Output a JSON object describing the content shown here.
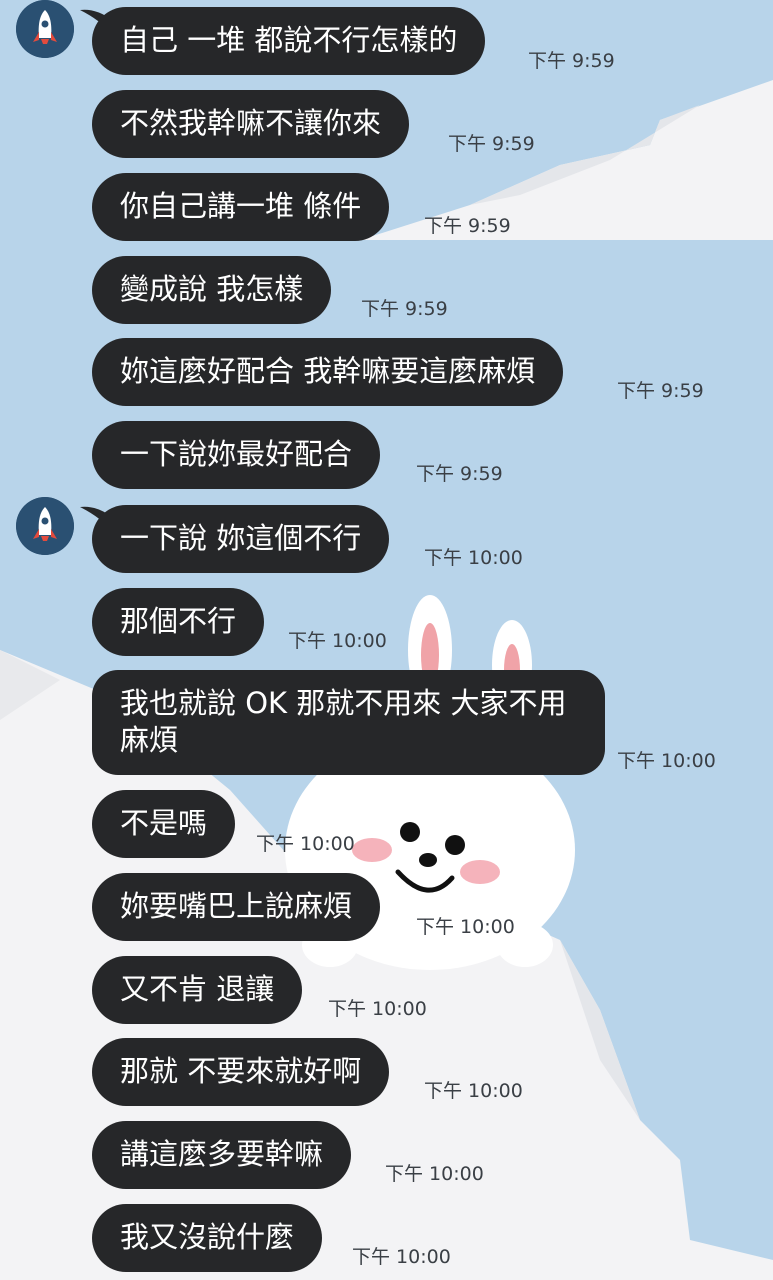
{
  "colors": {
    "background": "#b8d4ea",
    "bubble": "#262729",
    "bubble_text": "#ffffff",
    "timestamp": "#3a3f45"
  },
  "background_art": "bunny-character-on-ice-floes",
  "contact": {
    "avatar_icon": "rocket-icon"
  },
  "messages": [
    {
      "text": "自己 一堆 都說不行怎樣的",
      "time": "下午 9:59"
    },
    {
      "text": "不然我幹嘛不讓你來",
      "time": "下午 9:59"
    },
    {
      "text": "你自己講一堆 條件",
      "time": "下午 9:59"
    },
    {
      "text": "變成說 我怎樣",
      "time": "下午 9:59"
    },
    {
      "text": "妳這麼好配合 我幹嘛要這麼麻煩",
      "time": "下午 9:59"
    },
    {
      "text": "一下說妳最好配合",
      "time": "下午 9:59"
    },
    {
      "text": "一下說 妳這個不行",
      "time": "下午 10:00"
    },
    {
      "text": "那個不行",
      "time": "下午 10:00"
    },
    {
      "text": "我也就說 OK 那就不用來 大家不用麻煩",
      "time": "下午 10:00"
    },
    {
      "text": "不是嗎",
      "time": "下午 10:00"
    },
    {
      "text": "妳要嘴巴上說麻煩",
      "time": "下午 10:00"
    },
    {
      "text": "又不肯 退讓",
      "time": "下午 10:00"
    },
    {
      "text": "那就 不要來就好啊",
      "time": "下午 10:00"
    },
    {
      "text": "講這麼多要幹嘛",
      "time": "下午 10:00"
    },
    {
      "text": "我又沒說什麼",
      "time": "下午 10:00"
    }
  ]
}
